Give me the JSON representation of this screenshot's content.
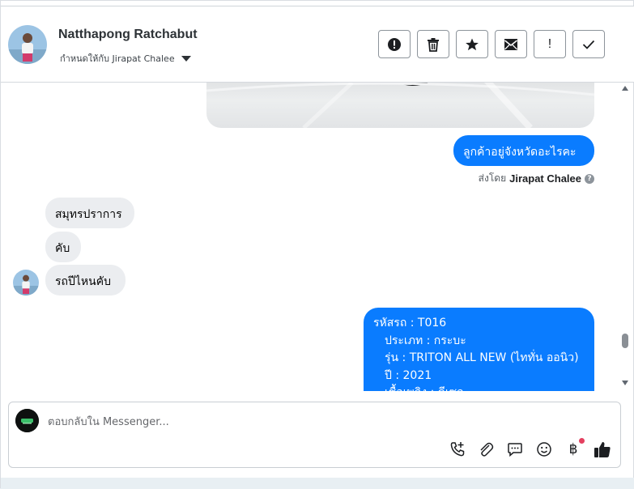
{
  "header": {
    "contact_name": "Natthapong Ratchabut",
    "assigned_label": "กำหนดให้กับ Jirapat Chalee"
  },
  "toolbar": {
    "spam_label": "!",
    "done_label": "✓"
  },
  "messages": {
    "outgoing_question": "ลูกค้าอยู่จังหวัดอะไรคะ",
    "sent_by_prefix": "ส่งโดย",
    "sent_by_name": "Jirapat Chalee",
    "incoming": [
      "สมุทรปราการ",
      "คับ",
      "รถปีไหนคับ"
    ],
    "detail_lines": [
      "รหัสรถ : T016",
      "ประเภท : กระบะ",
      "รุ่น : TRITON ALL NEW (ไททั่น ออนิว)",
      "ปี : 2021",
      "เชื้อเพลิง : ดีเซล"
    ]
  },
  "composer": {
    "placeholder": "ตอบกลับใน Messenger...",
    "baht_symbol": "฿"
  },
  "colors": {
    "accent": "#0a7cff",
    "incoming_bubble": "#ebedf0",
    "notification_dot": "#e4405f"
  },
  "icons": [
    "alert-circle-icon",
    "trash-icon",
    "star-icon",
    "mail-icon",
    "exclamation-icon",
    "check-icon",
    "call-add-icon",
    "paperclip-icon",
    "saved-reply-icon",
    "emoji-icon",
    "baht-icon",
    "thumbs-up-icon",
    "chevron-down-icon"
  ]
}
